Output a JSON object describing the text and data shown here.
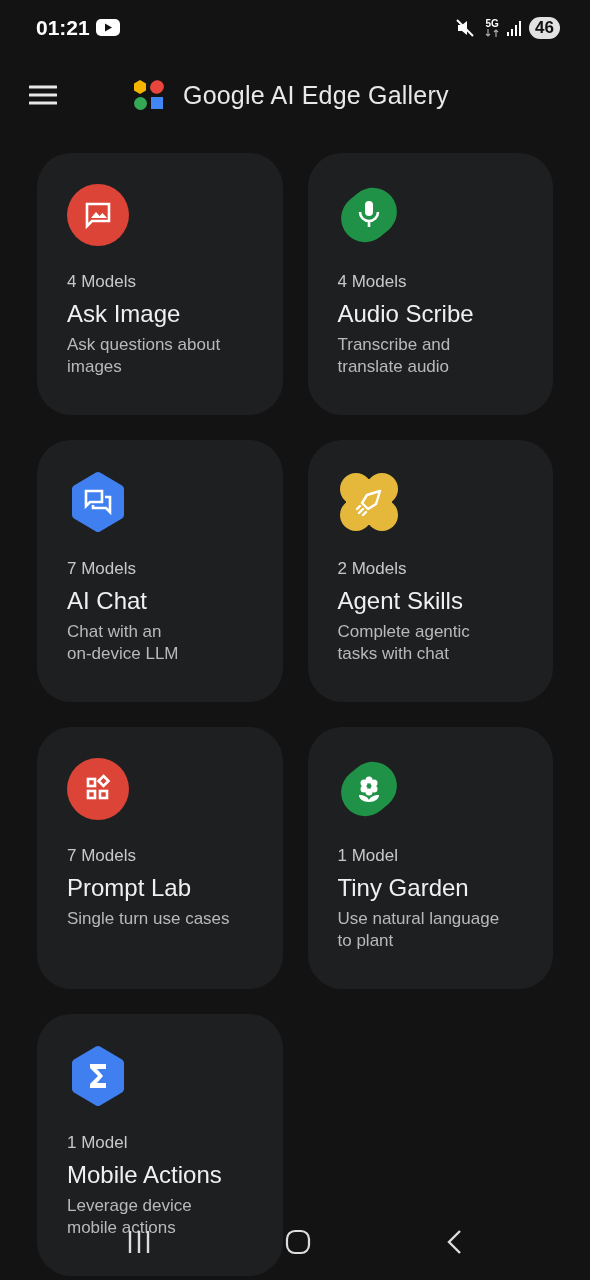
{
  "status_bar": {
    "time": "01:21",
    "network": "5G",
    "battery": "46"
  },
  "app_bar": {
    "title": "Google AI Edge Gallery"
  },
  "tasks": [
    {
      "color": "#dc4437",
      "models": "4 Models",
      "title": "Ask Image",
      "description": "Ask questions about\nimages"
    },
    {
      "color": "#1f9247",
      "models": "4 Models",
      "title": "Audio Scribe",
      "description": "Transcribe and\ntranslate audio"
    },
    {
      "color": "#3f7ff0",
      "models": "7 Models",
      "title": "AI Chat",
      "description": "Chat with an\non-device LLM"
    },
    {
      "color": "#e5b83c",
      "models": "2 Models",
      "title": "Agent Skills",
      "description": "Complete agentic\ntasks with chat"
    },
    {
      "color": "#dc4437",
      "models": "7 Models",
      "title": "Prompt Lab",
      "description": "Single turn use cases"
    },
    {
      "color": "#1f9247",
      "models": "1 Model",
      "title": "Tiny Garden",
      "description": "Use natural language\nto plant"
    },
    {
      "color": "#3f7ff0",
      "models": "1 Model",
      "title": "Mobile Actions",
      "description": "Leverage device\nmobile actions"
    }
  ]
}
